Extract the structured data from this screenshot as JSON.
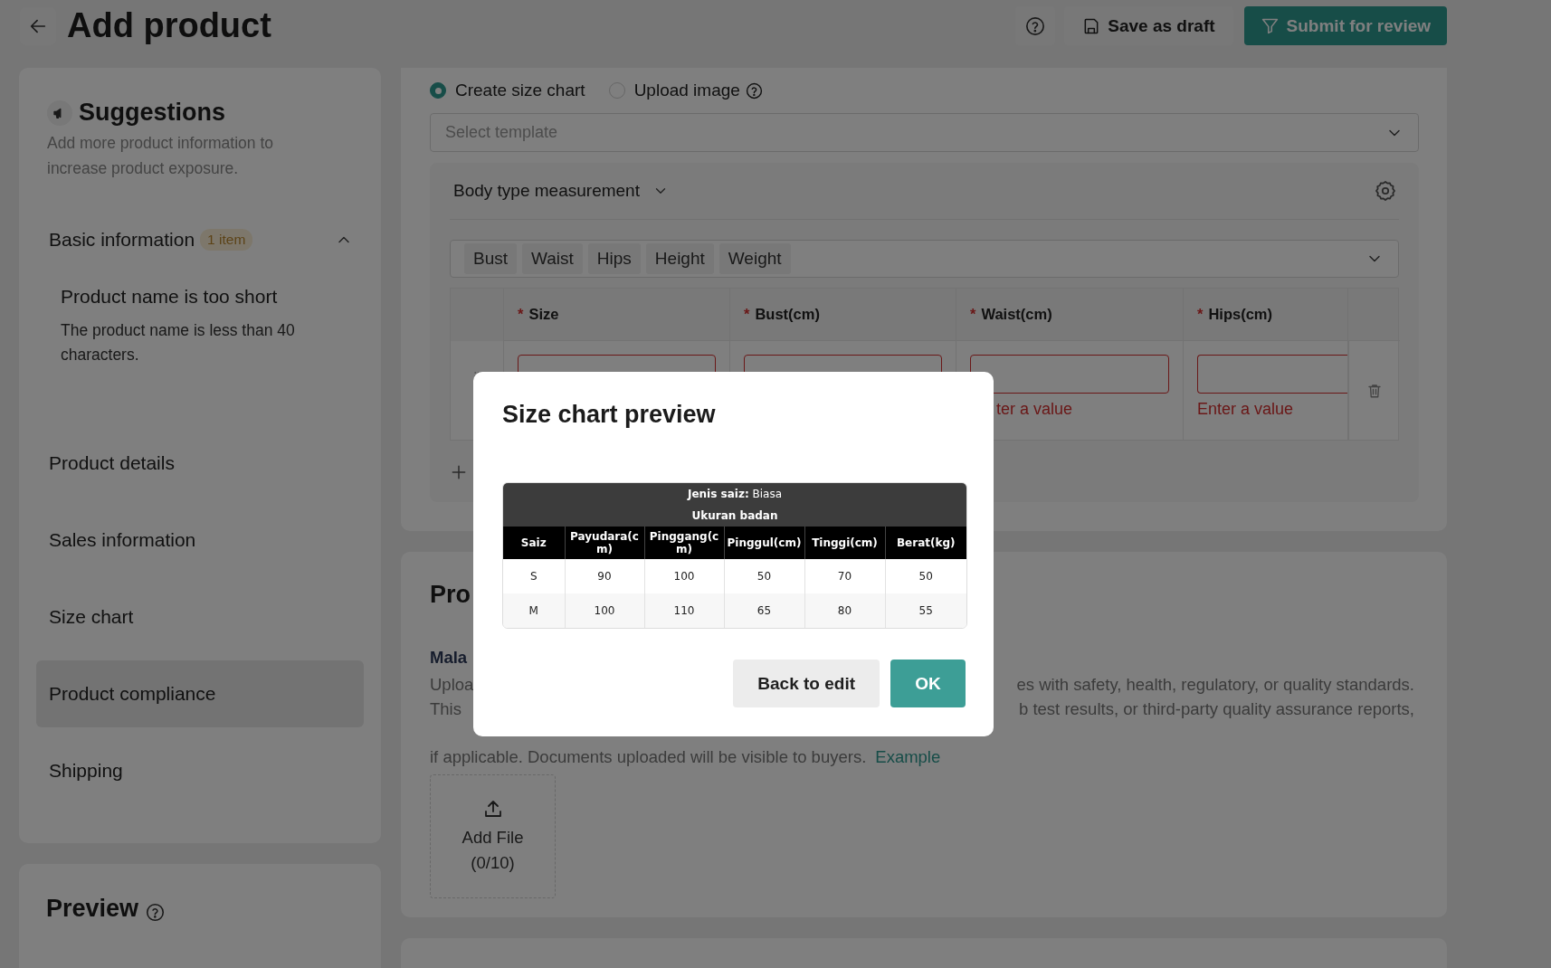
{
  "header": {
    "title": "Add product",
    "buttons": [
      {
        "kind": "help"
      },
      {
        "kind": "draft",
        "label": "Save as draft"
      },
      {
        "kind": "submit",
        "label": "Submit for review"
      }
    ]
  },
  "sidebar": {
    "suggestions": {
      "title": "Suggestions",
      "text": "Add more product information to increase product exposure."
    },
    "sections": [
      {
        "label": "Basic information",
        "badge": "1 item",
        "expanded": true,
        "selected": false,
        "children": [
          {
            "title": "Product name is too short",
            "text": "The product name is less than 40 characters."
          }
        ]
      },
      {
        "label": "Product details",
        "selected": false
      },
      {
        "label": "Sales information",
        "selected": false
      },
      {
        "label": "Size chart",
        "selected": false
      },
      {
        "label": "Product compliance",
        "selected": true
      },
      {
        "label": "Shipping",
        "selected": false
      }
    ]
  },
  "preview": {
    "title": "Preview"
  },
  "size_chart": {
    "options": [
      {
        "label": "Create size chart",
        "selected": true,
        "help": false
      },
      {
        "label": "Upload image",
        "selected": false,
        "help": true
      }
    ],
    "template": {
      "placeholder": "Select template"
    },
    "measurement": {
      "label": "Body type measurement",
      "tags": [
        "Bust",
        "Waist",
        "Hips",
        "Height",
        "Weight"
      ],
      "columns": [
        {
          "mark": "*",
          "label": "Size"
        },
        {
          "mark": "*",
          "label": "Bust(cm)"
        },
        {
          "mark": "*",
          "label": "Waist(cm)"
        },
        {
          "mark": "*",
          "label": "Hips(cm)"
        }
      ],
      "rows": [
        {
          "cells": [
            {
              "invalid": true
            },
            {
              "invalid": true
            },
            {
              "invalid": true,
              "error": "ter a value"
            },
            {
              "invalid": true,
              "error": "Enter a value"
            }
          ]
        }
      ]
    }
  },
  "compliance": {
    "heading": "Pro",
    "region": "Mala",
    "lines": [
      {
        "left": "Uploa",
        "right": "es with safety, health, regulatory, or quality standards."
      },
      {
        "left": "This",
        "right": "b test results, or third-party quality assurance reports,"
      }
    ],
    "last_line": "if applicable. Documents uploaded will be visible to buyers.",
    "link": "Example",
    "upload": {
      "label": "Add File",
      "count": "(0/10)"
    }
  },
  "modal": {
    "title": "Size chart preview",
    "table": {
      "caption": "**Jenis saiz:** Biasa",
      "subcaption": "Ukuran badan",
      "columns": [
        "Saiz",
        "Payudara(cm)",
        "Pinggang(cm)",
        "Pinggul(cm)",
        "Tinggi(cm)",
        "Berat(kg)"
      ],
      "rows": [
        [
          "S",
          "90",
          "100",
          "50",
          "70",
          "50"
        ],
        [
          "M",
          "100",
          "110",
          "65",
          "80",
          "55"
        ]
      ]
    },
    "buttons": [
      {
        "kind": "secondary",
        "label": "Back to edit"
      },
      {
        "kind": "primary",
        "label": "OK"
      }
    ]
  }
}
